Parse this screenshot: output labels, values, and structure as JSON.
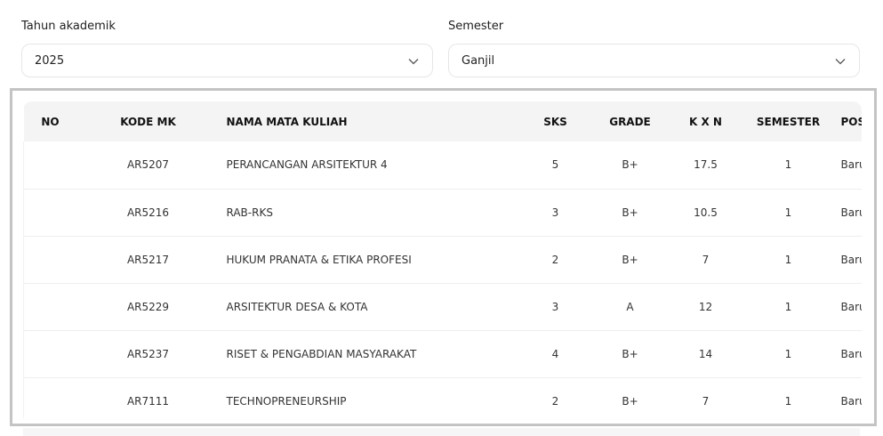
{
  "filters": {
    "year": {
      "label": "Tahun akademik",
      "value": "2025"
    },
    "semester": {
      "label": "Semester",
      "value": "Ganjil"
    }
  },
  "table": {
    "headers": [
      "NO",
      "KODE MK",
      "NAMA MATA KULIAH",
      "SKS",
      "GRADE",
      "K X N",
      "SEMESTER",
      "POSISI"
    ],
    "rows": [
      [
        "",
        "AR5207",
        "PERANCANGAN ARSITEKTUR 4",
        "5",
        "B+",
        "17.5",
        "1",
        "Baru"
      ],
      [
        "",
        "AR5216",
        "RAB-RKS",
        "3",
        "B+",
        "10.5",
        "1",
        "Baru"
      ],
      [
        "",
        "AR5217",
        "HUKUM PRANATA & ETIKA PROFESI",
        "2",
        "B+",
        "7",
        "1",
        "Baru"
      ],
      [
        "",
        "AR5229",
        "ARSITEKTUR DESA & KOTA",
        "3",
        "A",
        "12",
        "1",
        "Baru"
      ],
      [
        "",
        "AR5237",
        "RISET & PENGABDIAN MASYARAKAT",
        "4",
        "B+",
        "14",
        "1",
        "Baru"
      ],
      [
        "",
        "AR7111",
        "TECHNOPRENEURSHIP",
        "2",
        "B+",
        "7",
        "1",
        "Baru"
      ]
    ]
  }
}
